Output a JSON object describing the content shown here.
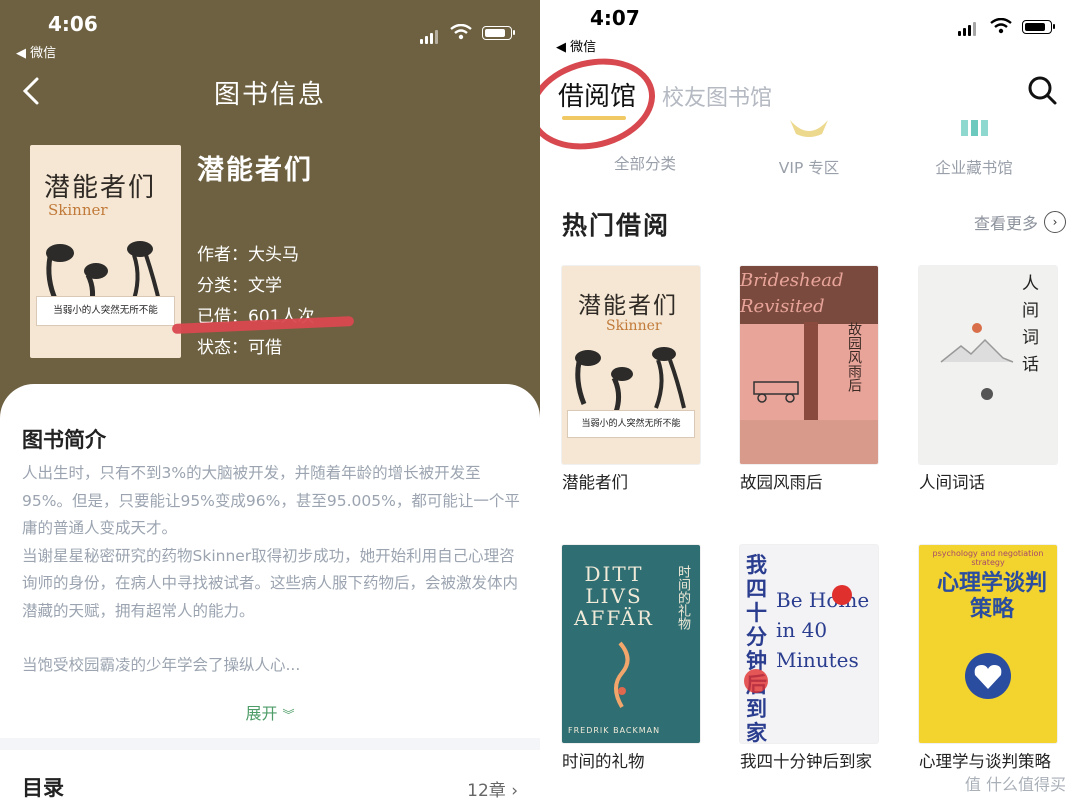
{
  "left": {
    "status": {
      "time": "4:06",
      "back_app": "◀ 微信"
    },
    "nav": {
      "title": "图书信息"
    },
    "book": {
      "cover_title": "潜能者们",
      "cover_subtitle": "Skinner",
      "cover_band": "当弱小的人突然无所不能",
      "title": "潜能者们",
      "author": "作者：大头马",
      "category": "分类：文学",
      "borrowed": "已借：601人次",
      "status": "状态：可借"
    },
    "intro": {
      "heading": "图书简介",
      "paragraphs": [
        "人出生时，只有不到3%的大脑被开发，并随着年龄的增长被开发至95%。但是，只要能让95%变成96%，甚至95.005%，都可能让一个平庸的普通人变成天才。",
        "当谢星星秘密研究的药物Skinner取得初步成功，她开始利用自己心理咨询师的身份，在病人中寻找被试者。这些病人服下药物后，会被激发体内潜藏的天赋，拥有超常人的能力。",
        "",
        "当饱受校园霸凌的少年学会了操纵人心..."
      ],
      "expand_label": "展开"
    },
    "toc": {
      "heading": "目录",
      "count": "12章"
    },
    "colors": {
      "header_bg": "#6e6141",
      "accent_green": "#4e9d68",
      "mark_red": "#d8484f"
    }
  },
  "right": {
    "status": {
      "time": "4:07",
      "back_app": "◀ 微信"
    },
    "tabs": {
      "active": "借阅馆",
      "other": "校友图书馆"
    },
    "categories": [
      {
        "label": "全部分类",
        "icon": "all-categories-icon"
      },
      {
        "label": "VIP 专区",
        "icon": "vip-crown-icon"
      },
      {
        "label": "企业藏书馆",
        "icon": "enterprise-library-icon"
      }
    ],
    "hot": {
      "heading": "热门借阅",
      "more_label": "查看更多"
    },
    "books": [
      {
        "name": "潜能者们",
        "cover_text": "潜能者们",
        "cover_sub": "Skinner",
        "cover_band": "当弱小的人突然无所不能"
      },
      {
        "name": "故园风雨后",
        "cover_text": "Brideshead Revisited",
        "cover_sub": "故园风雨后"
      },
      {
        "name": "人间词话",
        "cover_text": "人间词话"
      },
      {
        "name": "时间的礼物",
        "cover_text": "DITT LIVS AFFÄR",
        "cover_sub": "时间的礼物",
        "cover_author": "FREDRIK BACKMAN"
      },
      {
        "name": "我四十分钟后到家",
        "cover_text": "我四十分钟后到家",
        "cover_sub": "Be Home in 40 Minutes"
      },
      {
        "name": "心理学与谈判策略",
        "cover_text": "心理学谈判策略",
        "cover_sub": "psychology and negotiation strategy"
      }
    ],
    "watermark": "值 什么值得买",
    "colors": {
      "tab_bar": "#f0c864",
      "mark_red": "#d8484f"
    }
  }
}
